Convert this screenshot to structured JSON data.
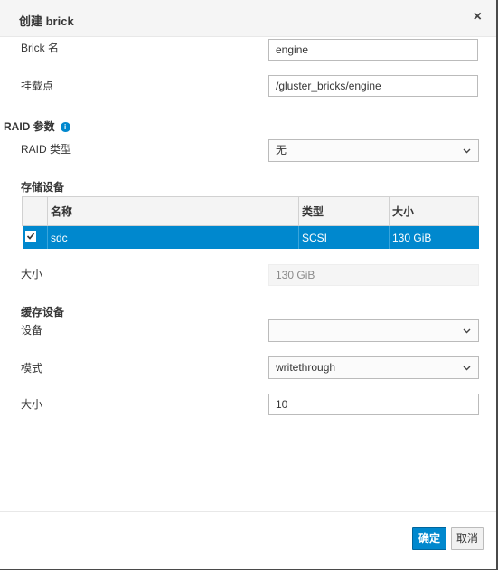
{
  "dialog": {
    "title": "创建 brick",
    "close": "×"
  },
  "form": {
    "brick_name_label": "Brick 名",
    "brick_name_value": "engine",
    "mount_label": "挂载点",
    "mount_value": "/gluster_bricks/engine",
    "raid_section": "RAID 参数",
    "raid_info_icon": "i",
    "raid_type_label": "RAID 类型",
    "raid_type_value": "无",
    "storage_section": "存储设备",
    "size_label": "大小",
    "size_value": "130 GiB",
    "cache_section": "缓存设备",
    "device_label": "设备",
    "device_value": "",
    "mode_label": "模式",
    "mode_value": "writethrough",
    "cache_size_label": "大小",
    "cache_size_value": "10"
  },
  "table": {
    "headers": [
      "名称",
      "类型",
      "大小"
    ],
    "rows": [
      {
        "checked": true,
        "name": "sdc",
        "type": "SCSI",
        "size": "130 GiB"
      }
    ]
  },
  "footer": {
    "ok": "确定",
    "cancel": "取消"
  },
  "colors": {
    "accent": "#0088ce"
  }
}
